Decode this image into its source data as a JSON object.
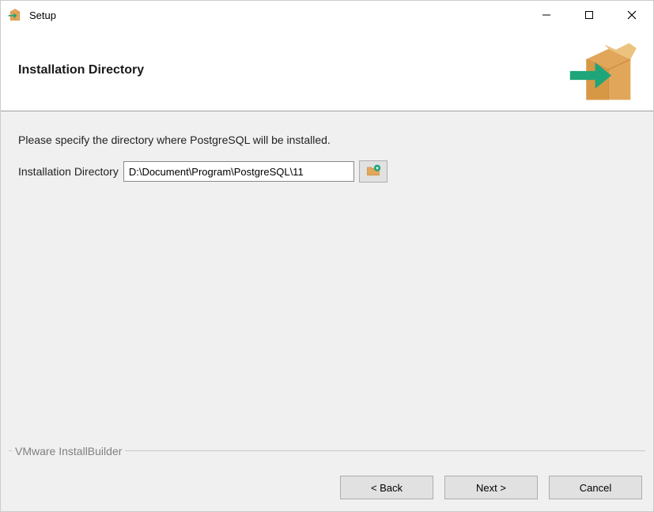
{
  "titlebar": {
    "title": "Setup"
  },
  "header": {
    "title": "Installation Directory"
  },
  "body": {
    "instruction": "Please specify the directory where PostgreSQL will be installed.",
    "dir_label": "Installation Directory",
    "dir_value": "D:\\Document\\Program\\PostgreSQL\\11",
    "builder_label": "VMware InstallBuilder"
  },
  "footer": {
    "back": "< Back",
    "next": "Next >",
    "cancel": "Cancel"
  }
}
